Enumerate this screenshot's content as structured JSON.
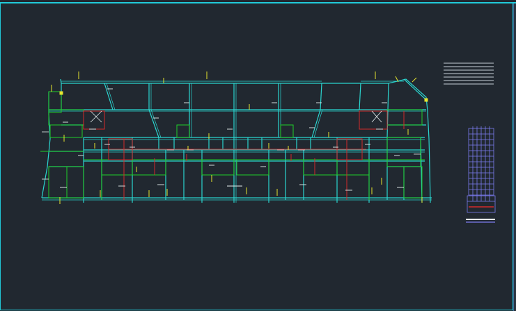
{
  "app": {
    "title": ""
  },
  "canvas": {
    "background": "#212830",
    "layer_colors": {
      "walls": "#2bd6d0",
      "outline": "#27c2c8",
      "green": "#1fcf2a",
      "yellow": "#e6e62e",
      "red": "#d42a2a",
      "white": "#e8f0f0",
      "legend": "#7c7cf0",
      "frame": "#21c8d8"
    }
  },
  "elements": {
    "floor_plan": "floor-plan-drawing",
    "text_block": "drawing-notes-lines",
    "elevation_legend": "building-elevation-legend"
  }
}
